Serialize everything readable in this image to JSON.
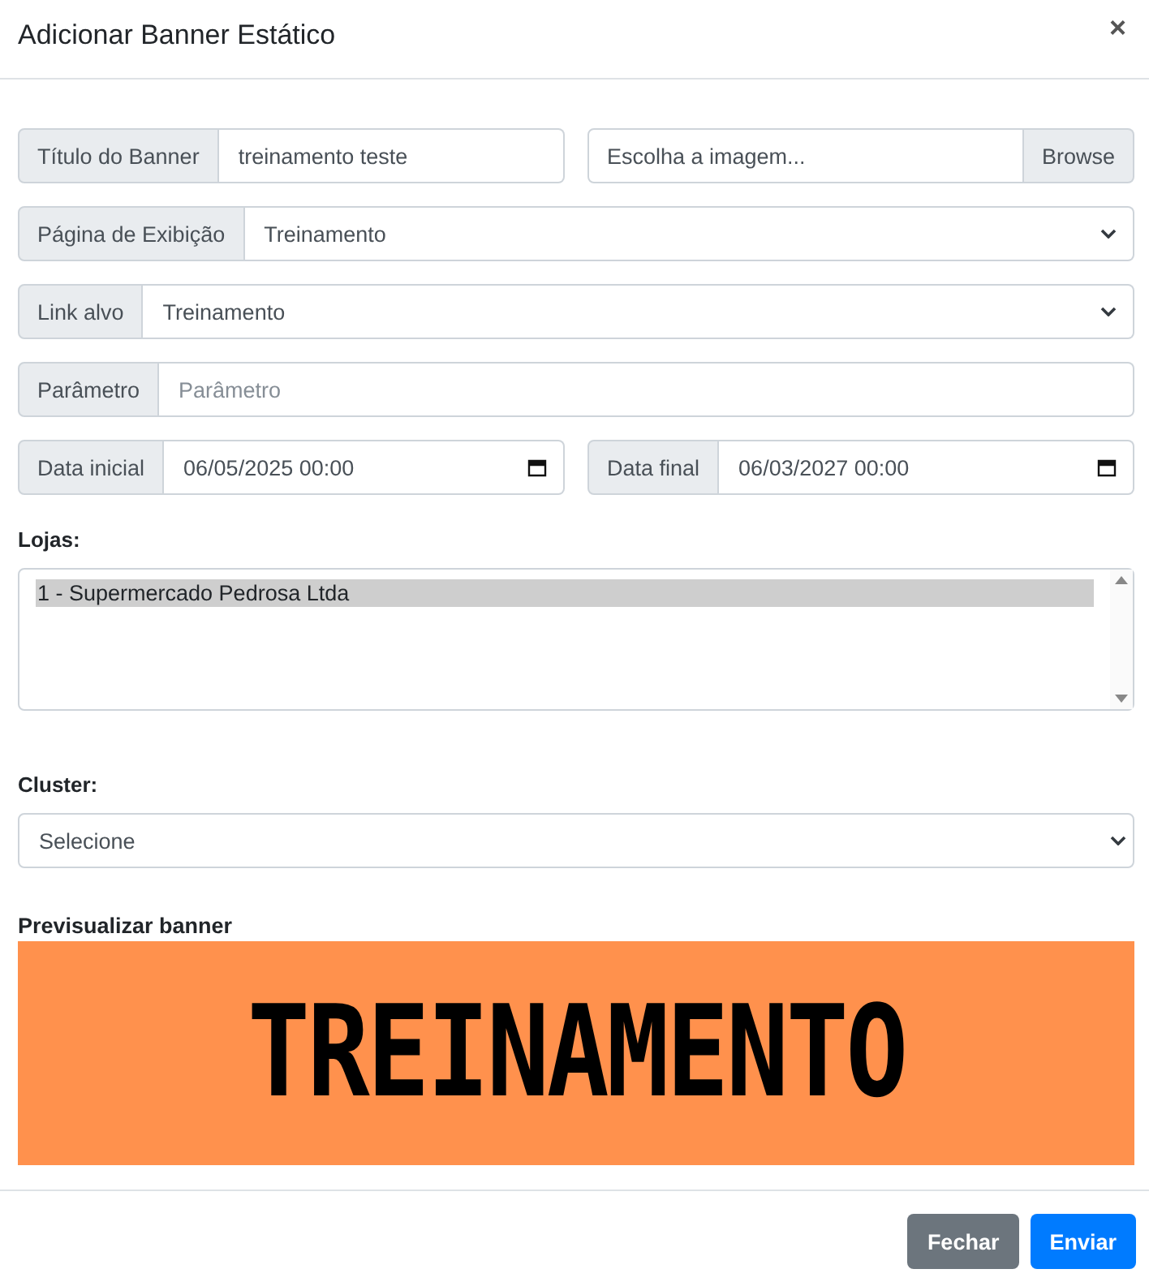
{
  "modal": {
    "title": "Adicionar Banner Estático",
    "close": "×"
  },
  "rows": [
    [
      {
        "kind": "text",
        "label": "Título do Banner",
        "value": "treinamento teste"
      },
      {
        "kind": "file",
        "text": "Escolha a imagem...",
        "button": "Browse"
      }
    ],
    [
      {
        "kind": "select",
        "label": "Página de Exibição",
        "value": "Treinamento"
      }
    ],
    [
      {
        "kind": "select",
        "label": "Link alvo",
        "value": "Treinamento"
      }
    ],
    [
      {
        "kind": "text",
        "label": "Parâmetro",
        "placeholder": "Parâmetro"
      }
    ],
    [
      {
        "kind": "date",
        "label": "Data inicial",
        "value": "06/05/2025 00:00"
      },
      {
        "kind": "date",
        "label": "Data final",
        "value": "06/03/2027 00:00"
      }
    ]
  ],
  "stores": {
    "label": "Lojas:",
    "options": [
      {
        "text": "1 - Supermercado Pedrosa Ltda",
        "selected": true
      }
    ]
  },
  "cluster": {
    "label": "Cluster:",
    "value": "Selecione"
  },
  "preview": {
    "label": "Previsualizar banner",
    "text": "TREINAMENTO"
  },
  "buttons": [
    {
      "kind": "secondary",
      "label": "Fechar"
    },
    {
      "kind": "primary",
      "label": "Enviar"
    }
  ]
}
